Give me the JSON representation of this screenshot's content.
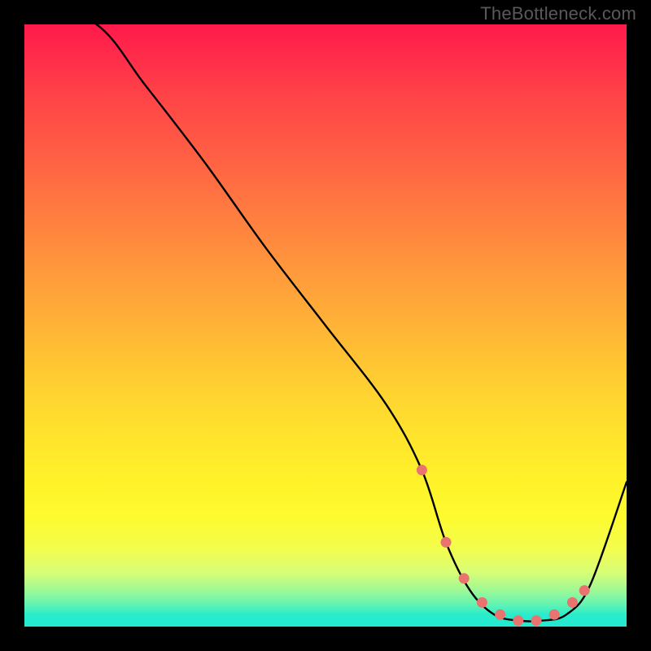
{
  "watermark": "TheBottleneck.com",
  "chart_data": {
    "type": "line",
    "title": "",
    "xlabel": "",
    "ylabel": "",
    "xlim": [
      0,
      100
    ],
    "ylim": [
      0,
      100
    ],
    "series": [
      {
        "name": "bottleneck-curve",
        "x": [
          0,
          12,
          20,
          30,
          40,
          50,
          60,
          66,
          70,
          74,
          78,
          82,
          86,
          90,
          94,
          100
        ],
        "values": [
          105,
          100,
          90,
          77,
          63,
          50,
          37,
          26,
          14,
          6,
          2,
          1,
          1,
          2,
          7,
          24
        ]
      }
    ],
    "markers": {
      "name": "highlight-points",
      "color": "#e8736f",
      "x": [
        66,
        70,
        73,
        76,
        79,
        82,
        85,
        88,
        91,
        93
      ],
      "values": [
        26,
        14,
        8,
        4,
        2,
        1,
        1,
        2,
        4,
        6
      ]
    }
  }
}
